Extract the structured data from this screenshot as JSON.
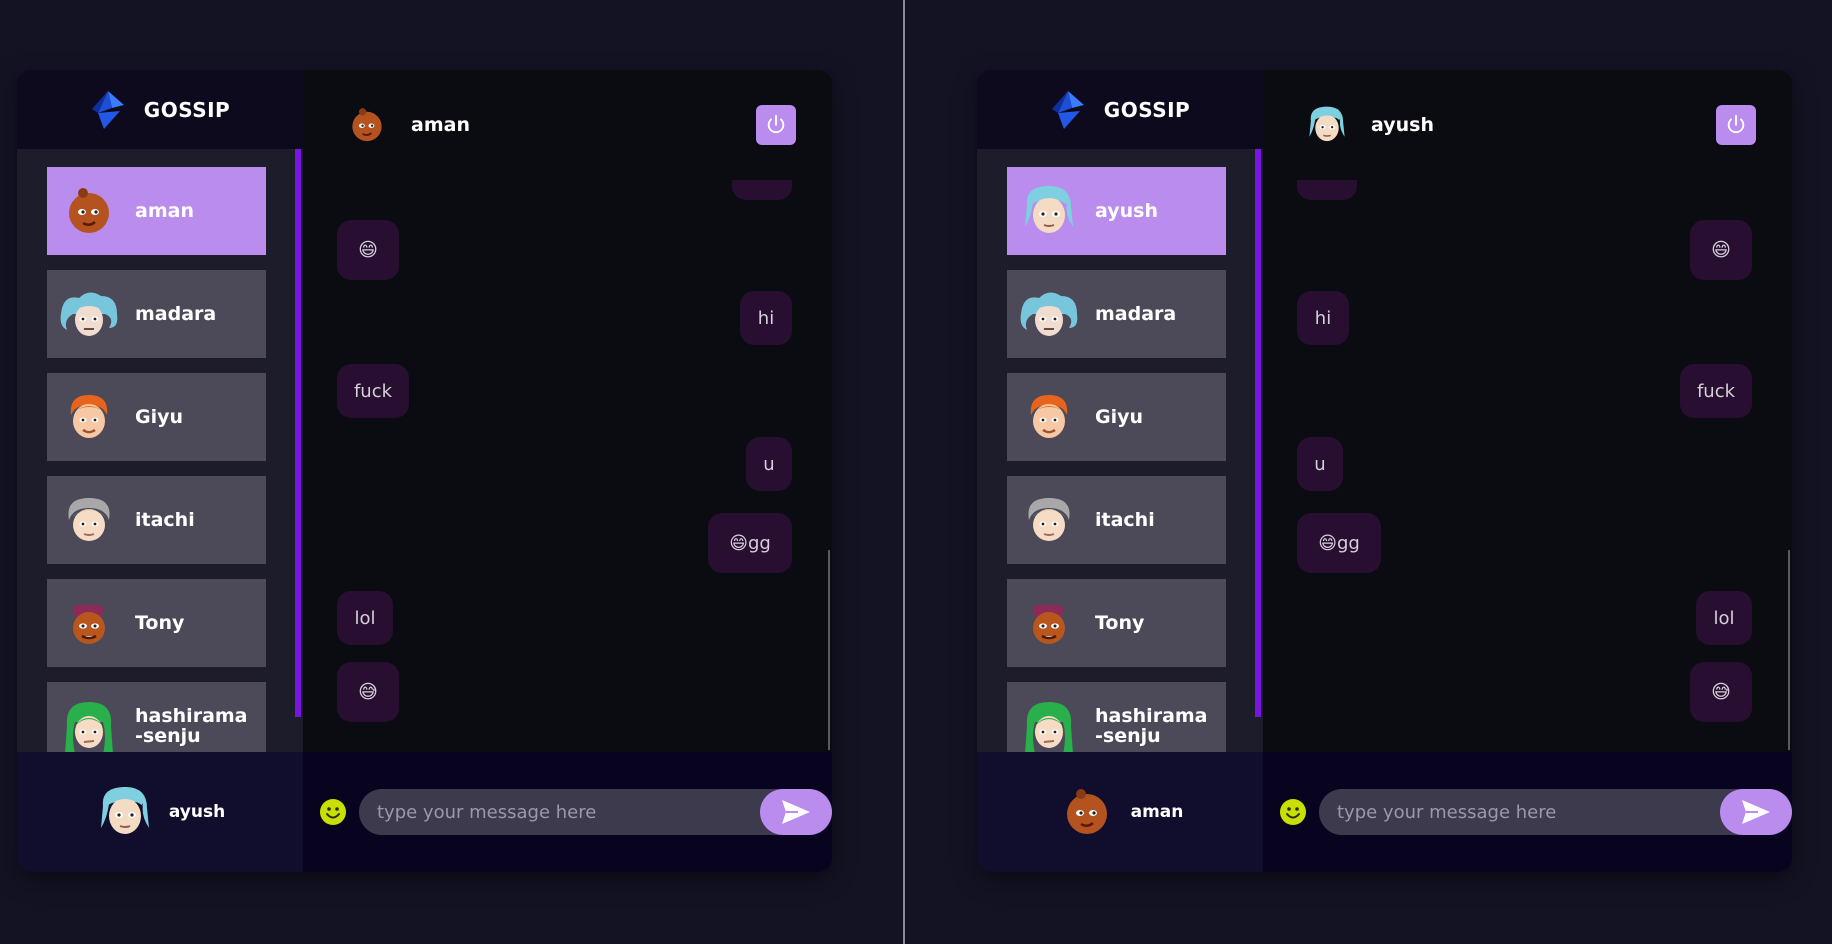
{
  "colors": {
    "background": "#131324",
    "accent": "#b98ced",
    "bubble": "#280f31",
    "contact_item": "#4c4a58",
    "scroll_accent": "#7a14e0"
  },
  "panels": [
    {
      "brand": {
        "title": "GOSSIP",
        "logo_icon": "diamond-logo-icon"
      },
      "contacts": [
        {
          "name": "aman",
          "selected": true,
          "avatar_icon": "avatar-aman-icon"
        },
        {
          "name": "madara",
          "selected": false,
          "avatar_icon": "avatar-madara-icon"
        },
        {
          "name": "Giyu",
          "selected": false,
          "avatar_icon": "avatar-giyu-icon"
        },
        {
          "name": "itachi",
          "selected": false,
          "avatar_icon": "avatar-itachi-icon"
        },
        {
          "name": "Tony",
          "selected": false,
          "avatar_icon": "avatar-tony-icon"
        },
        {
          "name": "hashirama-senju",
          "selected": false,
          "avatar_icon": "avatar-hashirama-icon"
        }
      ],
      "current_user": {
        "name": "ayush"
      },
      "chat": {
        "header_name": "aman",
        "logout_icon": "power-icon",
        "messages": [
          {
            "text": "",
            "sender": "self"
          },
          {
            "text": "😄",
            "sender": "other"
          },
          {
            "text": "hi",
            "sender": "self"
          },
          {
            "text": "fuck",
            "sender": "other"
          },
          {
            "text": "u",
            "sender": "self"
          },
          {
            "text": "😄gg",
            "sender": "self"
          },
          {
            "text": "lol",
            "sender": "other"
          },
          {
            "text": "😅",
            "sender": "other"
          }
        ],
        "input_placeholder": "type your message here",
        "send_icon": "send-icon",
        "emoji_icon": "smiley-icon"
      }
    },
    {
      "brand": {
        "title": "GOSSIP",
        "logo_icon": "diamond-logo-icon"
      },
      "contacts": [
        {
          "name": "ayush",
          "selected": true,
          "avatar_icon": "avatar-ayush-icon"
        },
        {
          "name": "madara",
          "selected": false,
          "avatar_icon": "avatar-madara-icon"
        },
        {
          "name": "Giyu",
          "selected": false,
          "avatar_icon": "avatar-giyu-icon"
        },
        {
          "name": "itachi",
          "selected": false,
          "avatar_icon": "avatar-itachi-icon"
        },
        {
          "name": "Tony",
          "selected": false,
          "avatar_icon": "avatar-tony-icon"
        },
        {
          "name": "hashirama-senju",
          "selected": false,
          "avatar_icon": "avatar-hashirama-icon"
        }
      ],
      "current_user": {
        "name": "aman"
      },
      "chat": {
        "header_name": "ayush",
        "logout_icon": "power-icon",
        "messages": [
          {
            "text": "",
            "sender": "other"
          },
          {
            "text": "😄",
            "sender": "self"
          },
          {
            "text": "hi",
            "sender": "other"
          },
          {
            "text": "fuck",
            "sender": "self"
          },
          {
            "text": "u",
            "sender": "other"
          },
          {
            "text": "😄gg",
            "sender": "other"
          },
          {
            "text": "lol",
            "sender": "self"
          },
          {
            "text": "😅",
            "sender": "self"
          }
        ],
        "input_placeholder": "type your message here",
        "send_icon": "send-icon",
        "emoji_icon": "smiley-icon"
      }
    }
  ]
}
